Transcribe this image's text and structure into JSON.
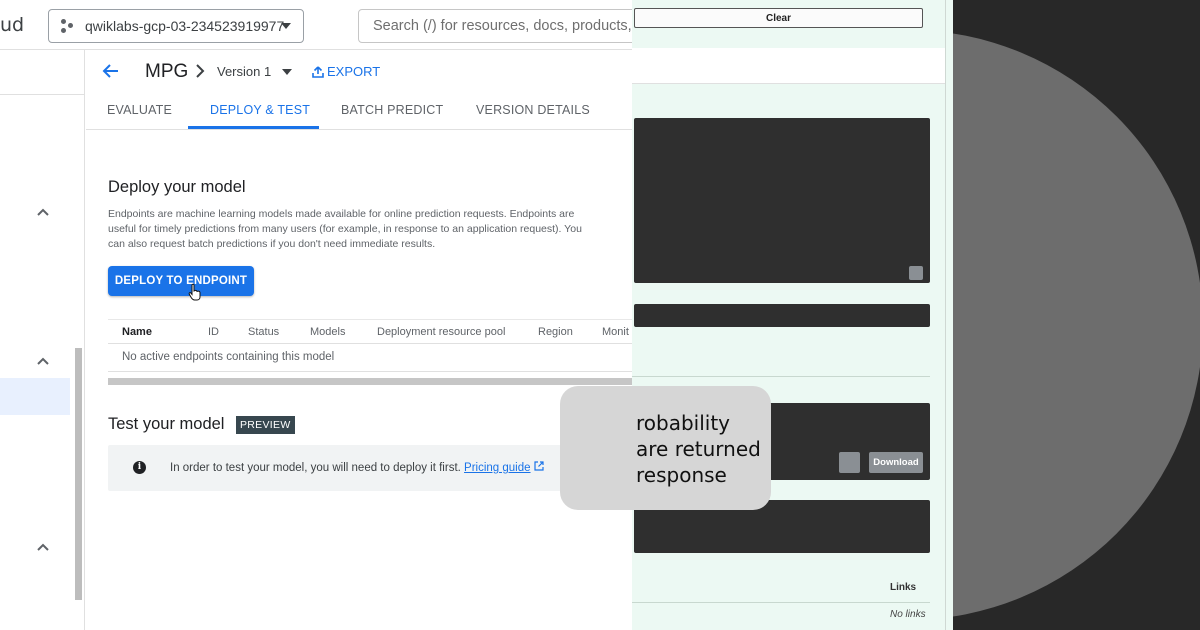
{
  "brand": {
    "text": "ud"
  },
  "project_picker": {
    "name": "qwiklabs-gcp-03-234523919977"
  },
  "search": {
    "placeholder": "Search (/) for resources, docs, products,"
  },
  "header": {
    "model_name": "MPG",
    "version": "Version 1",
    "export_label": "EXPORT"
  },
  "tabs": [
    {
      "label": "EVALUATE",
      "active": false
    },
    {
      "label": "DEPLOY & TEST",
      "active": true
    },
    {
      "label": "BATCH PREDICT",
      "active": false
    },
    {
      "label": "VERSION DETAILS",
      "active": false
    }
  ],
  "deploy": {
    "title": "Deploy your model",
    "description": "Endpoints are machine learning models made available for online prediction requests. Endpoints are useful for timely predictions from many users (for example, in response to an application request). You can also request batch predictions if you don't need immediate results.",
    "button_label": "DEPLOY TO ENDPOINT"
  },
  "endpoints_table": {
    "columns": [
      "Name",
      "ID",
      "Status",
      "Models",
      "Deployment resource pool",
      "Region",
      "Monit"
    ],
    "empty_message": "No active endpoints containing this model"
  },
  "test": {
    "title": "Test your model",
    "badge": "PREVIEW",
    "info_text": "In order to test your model, you will need to deploy it first.",
    "link_text": "Pricing guide"
  },
  "panel": {
    "clear_label": "Clear",
    "download_label": "Download",
    "links_label": "Links",
    "no_links_label": "No links"
  },
  "tooltip": {
    "text": "robability\nare returned\nresponse"
  },
  "colors": {
    "accent": "#1a73e8",
    "panel_bg": "#ecf9f3",
    "dark_box": "#2f2f2f"
  }
}
